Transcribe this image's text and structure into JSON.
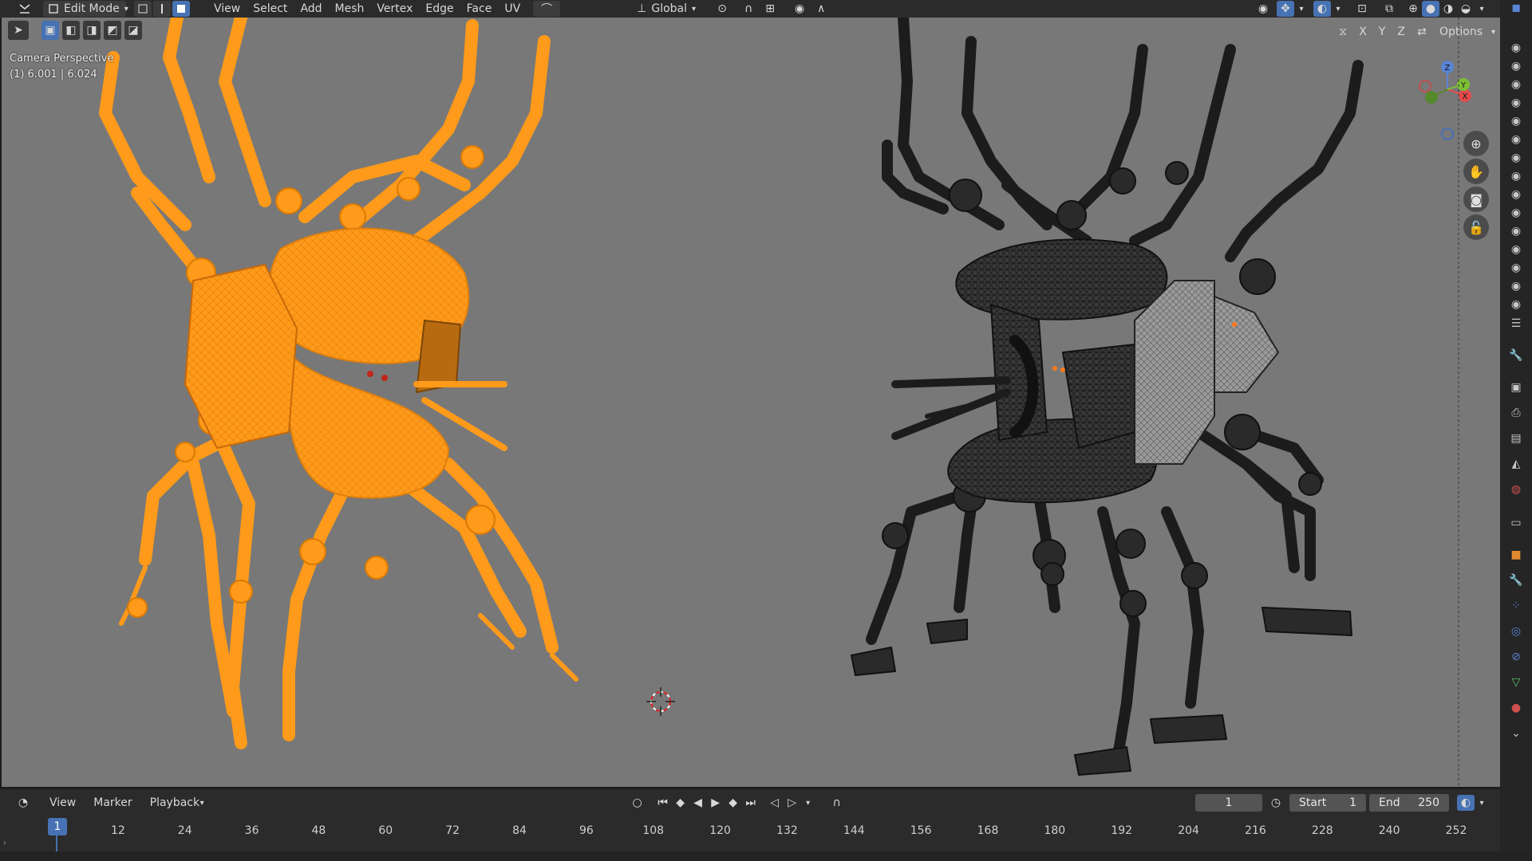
{
  "header": {
    "mode_label": "Edit Mode",
    "menus": [
      "View",
      "Select",
      "Add",
      "Mesh",
      "Vertex",
      "Edge",
      "Face",
      "UV"
    ],
    "transform_orientation": "Global",
    "options_label": "Options",
    "axis_x": "X",
    "axis_y": "Y",
    "axis_z": "Z"
  },
  "viewport": {
    "camera_label": "Camera Perspective",
    "frame_info": "(1) 6.001 | 6.024",
    "gizmo_z": "Z",
    "gizmo_y": "Y",
    "gizmo_x": "X"
  },
  "timeline": {
    "menus": [
      "View",
      "Marker",
      "Playback"
    ],
    "current_frame": "1",
    "start_label": "Start",
    "start_value": "1",
    "end_label": "End",
    "end_value": "250",
    "playhead_label": "1",
    "ticks": [
      "12",
      "24",
      "36",
      "48",
      "60",
      "72",
      "84",
      "96",
      "108",
      "120",
      "132",
      "144",
      "156",
      "168",
      "180",
      "192",
      "204",
      "216",
      "228",
      "240",
      "252"
    ]
  },
  "colors": {
    "selected_mesh": "#ff9a1a",
    "unselected_mesh": "#1c1c1c",
    "viewport_bg": "#787878",
    "accent": "#4772b3"
  }
}
